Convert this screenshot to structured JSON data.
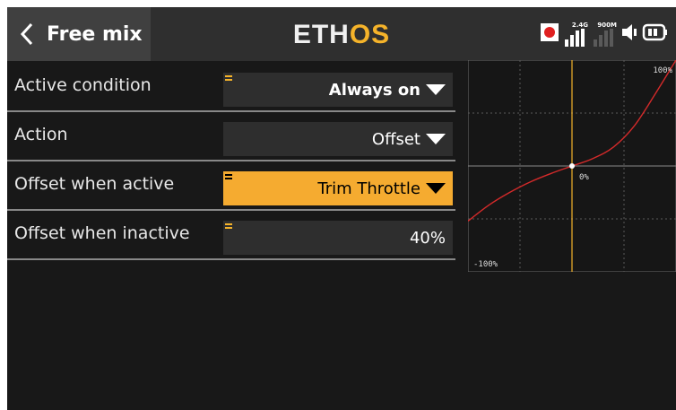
{
  "header": {
    "title": "Free mix",
    "logo_main": "ETH",
    "logo_accent": "OS",
    "status": {
      "band_1_label": "2.4G",
      "band_2_label": "900M"
    }
  },
  "rows": [
    {
      "label": "Active condition",
      "value": "Always on",
      "has_dropdown": true,
      "highlighted": false
    },
    {
      "label": "Action",
      "value": "Offset",
      "has_dropdown": true,
      "highlighted": false
    },
    {
      "label": "Offset when active",
      "value": "Trim Throttle",
      "has_dropdown": true,
      "highlighted": true
    },
    {
      "label": "Offset when inactive",
      "value": "40%",
      "has_dropdown": false,
      "highlighted": false
    }
  ],
  "chart_data": {
    "type": "line",
    "xlim": [
      -100,
      100
    ],
    "ylim": [
      -100,
      100
    ],
    "grid": true,
    "labels": {
      "top": "100%",
      "center": "0%",
      "bottom": "-100%"
    },
    "series": [
      {
        "x": [
          -100,
          -80,
          -60,
          -40,
          -20,
          0,
          20,
          40,
          60,
          80,
          100
        ],
        "values": [
          -52,
          -37,
          -25,
          -15,
          -7,
          0,
          7,
          18,
          38,
          68,
          100
        ]
      }
    ],
    "cursor_x": 0,
    "point": {
      "x": 0,
      "y": 0
    }
  },
  "colors": {
    "accent": "#f5ab30",
    "curve": "#d42a2a",
    "cursor": "#f5b32a",
    "record": "#e02020"
  }
}
